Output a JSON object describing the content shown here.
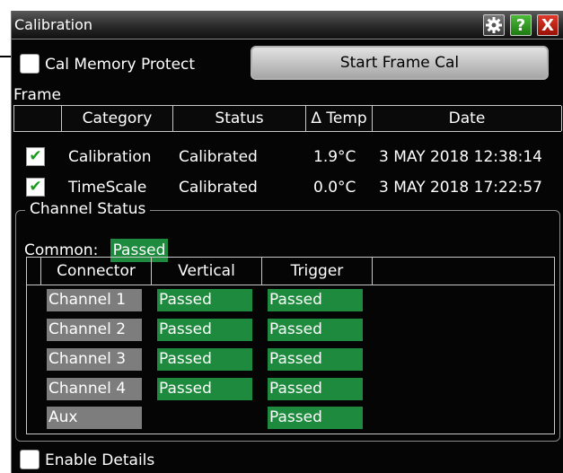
{
  "window": {
    "title": "Calibration"
  },
  "title_buttons": {
    "help": "?",
    "close": "X"
  },
  "cal_memory_protect": {
    "label": "Cal Memory Protect",
    "checked": false
  },
  "start_frame_cal": {
    "label": "Start Frame Cal"
  },
  "frame": {
    "label": "Frame",
    "columns": [
      "Category",
      "Status",
      "Δ Temp",
      "Date"
    ],
    "rows": [
      {
        "checked": true,
        "check_glyph": "✔",
        "category": "Calibration",
        "status": "Calibrated",
        "delta_temp": "1.9°C",
        "date": "3 MAY 2018 12:38:14"
      },
      {
        "checked": true,
        "check_glyph": "✔",
        "category": "TimeScale",
        "status": "Calibrated",
        "delta_temp": "0.0°C",
        "date": "3 MAY 2018 17:22:57"
      }
    ]
  },
  "channel_status": {
    "label": "Channel Status",
    "common_label": "Common:",
    "common_value": "Passed",
    "columns": [
      "Connector",
      "Vertical",
      "Trigger"
    ],
    "rows": [
      {
        "connector": "Channel 1",
        "vertical": "Passed",
        "trigger": "Passed"
      },
      {
        "connector": "Channel 2",
        "vertical": "Passed",
        "trigger": "Passed"
      },
      {
        "connector": "Channel 3",
        "vertical": "Passed",
        "trigger": "Passed"
      },
      {
        "connector": "Channel 4",
        "vertical": "Passed",
        "trigger": "Passed"
      },
      {
        "connector": "Aux",
        "vertical": "",
        "trigger": "Passed"
      }
    ]
  },
  "enable_details": {
    "label": "Enable Details",
    "checked": false
  },
  "colors": {
    "passed": "#1d8a3d",
    "connector_bg": "#7d7d7d",
    "dialog_bg": "#050505",
    "check_mark": "#1a9a1a"
  },
  "icons": {
    "settings": "gear-icon",
    "help": "help-icon",
    "close": "close-icon"
  }
}
